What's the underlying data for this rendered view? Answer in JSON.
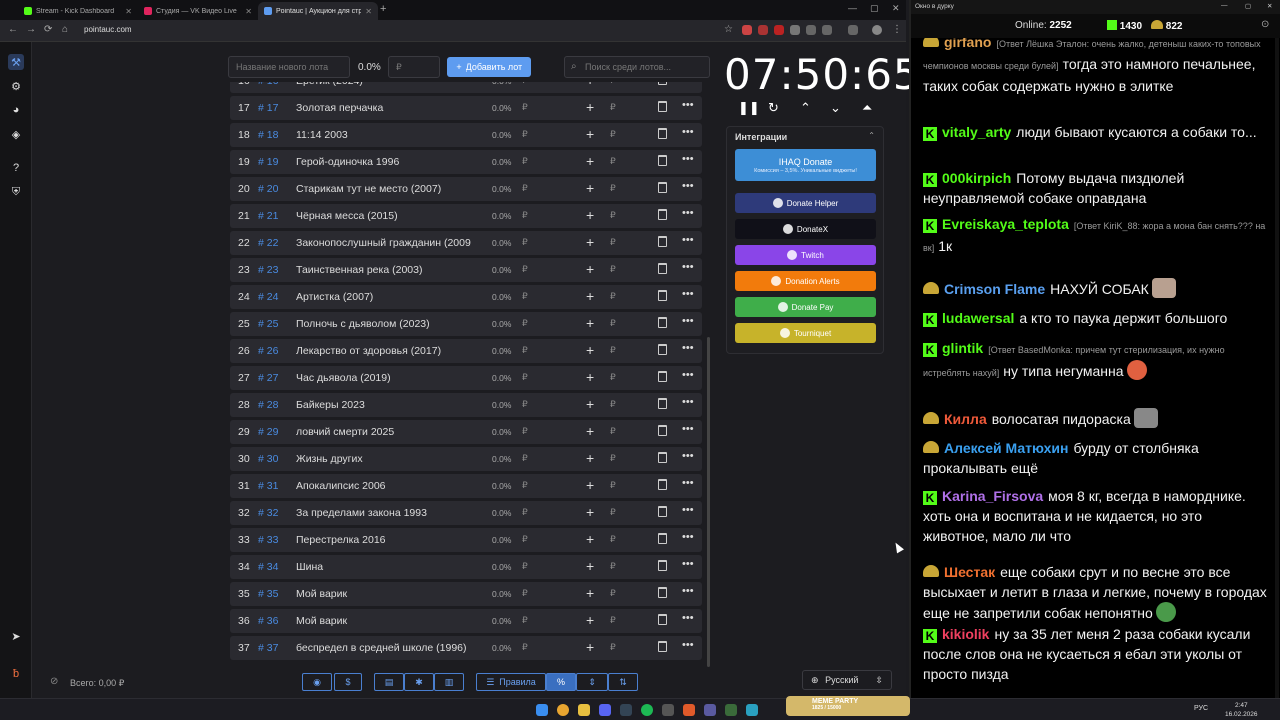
{
  "browser": {
    "tabs": [
      {
        "title": "Stream - Kick Dashboard",
        "color": "#53fc18"
      },
      {
        "title": "Студия — VK Видео Live",
        "color": "#e0245e"
      },
      {
        "title": "Pointauc | Аукцион для стрим",
        "color": "#5e9cf0"
      }
    ],
    "url": "pointauc.com"
  },
  "toolbar": {
    "new_lot_placeholder": "Название нового лота",
    "percent": "0.0%",
    "amount_placeholder": "₽",
    "add_button": "Добавить лот",
    "search_placeholder": "Поиск среди лотов..."
  },
  "lots": [
    {
      "num": "16",
      "hash": "# 16",
      "name": "Еретик (2024)",
      "pct": "0.0%"
    },
    {
      "num": "17",
      "hash": "# 17",
      "name": "Золотая перчачка",
      "pct": "0.0%"
    },
    {
      "num": "18",
      "hash": "# 18",
      "name": "11:14 2003",
      "pct": "0.0%"
    },
    {
      "num": "19",
      "hash": "# 19",
      "name": "Герой-одиночка 1996",
      "pct": "0.0%"
    },
    {
      "num": "20",
      "hash": "# 20",
      "name": "Старикам тут не место (2007)",
      "pct": "0.0%"
    },
    {
      "num": "21",
      "hash": "# 21",
      "name": "Чёрная месса (2015)",
      "pct": "0.0%"
    },
    {
      "num": "22",
      "hash": "# 22",
      "name": "Законопослушный гражданин (2009",
      "pct": "0.0%"
    },
    {
      "num": "23",
      "hash": "# 23",
      "name": "Таинственная река (2003)",
      "pct": "0.0%"
    },
    {
      "num": "24",
      "hash": "# 24",
      "name": "Артистка (2007)",
      "pct": "0.0%"
    },
    {
      "num": "25",
      "hash": "# 25",
      "name": "Полночь с дьяволом (2023)",
      "pct": "0.0%"
    },
    {
      "num": "26",
      "hash": "# 26",
      "name": "Лекарство от здоровья (2017)",
      "pct": "0.0%"
    },
    {
      "num": "27",
      "hash": "# 27",
      "name": "Час дьявола (2019)",
      "pct": "0.0%"
    },
    {
      "num": "28",
      "hash": "# 28",
      "name": "Байкеры 2023",
      "pct": "0.0%"
    },
    {
      "num": "29",
      "hash": "# 29",
      "name": "ловчий смерти 2025",
      "pct": "0.0%"
    },
    {
      "num": "30",
      "hash": "# 30",
      "name": "Жизнь других",
      "pct": "0.0%"
    },
    {
      "num": "31",
      "hash": "# 31",
      "name": "Апокалипсис 2006",
      "pct": "0.0%"
    },
    {
      "num": "32",
      "hash": "# 32",
      "name": "За пределами закона 1993",
      "pct": "0.0%"
    },
    {
      "num": "33",
      "hash": "# 33",
      "name": "Перестрелка 2016",
      "pct": "0.0%"
    },
    {
      "num": "34",
      "hash": "# 34",
      "name": "Шина",
      "pct": "0.0%"
    },
    {
      "num": "35",
      "hash": "# 35",
      "name": "Мой варик",
      "pct": "0.0%"
    },
    {
      "num": "36",
      "hash": "# 36",
      "name": "Мой варик",
      "pct": "0.0%"
    },
    {
      "num": "37",
      "hash": "# 37",
      "name": "беспредел в средней школе (1996)",
      "pct": "0.0%"
    }
  ],
  "currency": "₽",
  "timer": "07:50:65",
  "integrations": {
    "title": "Интеграции",
    "items": [
      {
        "label": "IHAQ Donate",
        "sub": "Комиссия – 3,5%. Уникальные виджеты!",
        "color": "#3d8ed6"
      },
      {
        "label": "Donate Helper",
        "color": "#2e3a7a"
      },
      {
        "label": "DonateX",
        "color": "#101018"
      },
      {
        "label": "Twitch",
        "color": "#8a45e8"
      },
      {
        "label": "Donation Alerts",
        "color": "#f27b0c"
      },
      {
        "label": "Donate Pay",
        "color": "#3fae4a"
      },
      {
        "label": "Tourniquet",
        "color": "#c7b32a"
      }
    ]
  },
  "footer": {
    "total": "Всего: 0,00 ₽",
    "rules": "Правила",
    "percent_symbol": "%",
    "dollar_symbol": "$",
    "language": "Русский"
  },
  "chat": {
    "window_title": "Окно в дурку",
    "online_label": "Online:",
    "online": "2252",
    "kick_count": "1430",
    "vk_count": "822",
    "messages": [
      {
        "user": "girfano",
        "color": "#e0a050",
        "badge": "vk",
        "reply": "[Ответ Лёшка Эталон: очень жалко, детеныш каких-то топовых чемпионов москвы среди булей]",
        "text": "тогда это намного печальнее, таких собак содержать нужно в элитке"
      },
      {
        "user": "vitaly_arty",
        "color": "#53fc18",
        "badge": "kick",
        "reply": "",
        "text": "люди бывают кусаются а собаки то..."
      },
      {
        "user": "000kirpich",
        "color": "#53fc18",
        "badge": "kick",
        "reply": "",
        "text": "Потому выдача пиздюлей неуправляемой собаке оправдана"
      },
      {
        "user": "Evreiskaya_teplota",
        "color": "#53fc18",
        "badge": "kick",
        "reply": "[Ответ KiriK_88: жора а мона бан снять??? на вк]",
        "text": "1к"
      },
      {
        "user": "Crimson Flame",
        "color": "#5aa0f0",
        "badge": "vk",
        "reply": "",
        "text": "НАХУЙ СОБАК"
      },
      {
        "user": "ludawersal",
        "color": "#53fc18",
        "badge": "kick",
        "reply": "",
        "text": "а кто то паука держит большого"
      },
      {
        "user": "glintik",
        "color": "#53fc18",
        "badge": "kick",
        "reply": "[Ответ BasedMonka: причем тут стерилизация, их нужно истреблять нахуй]",
        "text": "ну типа негуманна"
      },
      {
        "user": "Килла",
        "color": "#f05a3a",
        "badge": "vk",
        "reply": "",
        "text": "волосатая пидораска"
      },
      {
        "user": "Алексей Матюхин",
        "color": "#3aa0f0",
        "badge": "vk",
        "reply": "",
        "text": "бурду от столбняка прокалывать ещё"
      },
      {
        "user": "Karina_Firsova",
        "color": "#b070e8",
        "badge": "kick",
        "reply": "",
        "text": "моя 8 кг, всегда в наморднике. хоть она и воспитана и не кидается, но это животное, мало ли что"
      },
      {
        "user": "Шестак",
        "color": "#f07030",
        "badge": "vk",
        "reply": "",
        "text": "еще собаки срут и по весне это все высыхает и летит в глаза и легкие, почему в городах еще не запретили собак непонятно"
      },
      {
        "user": "kikiolik",
        "color": "#f04060",
        "badge": "kick",
        "reply": "",
        "text": "ну за 35 лет меня 2 раза собаки кусали после слов она не кусаеться я ебал эти уколы от просто пизда"
      }
    ]
  },
  "taskbar": {
    "lang": "РУС",
    "time": "2:47",
    "date": "16.02.2026",
    "meme_label": "MEME PARTY",
    "meme_sub": "1825 / 15000"
  }
}
